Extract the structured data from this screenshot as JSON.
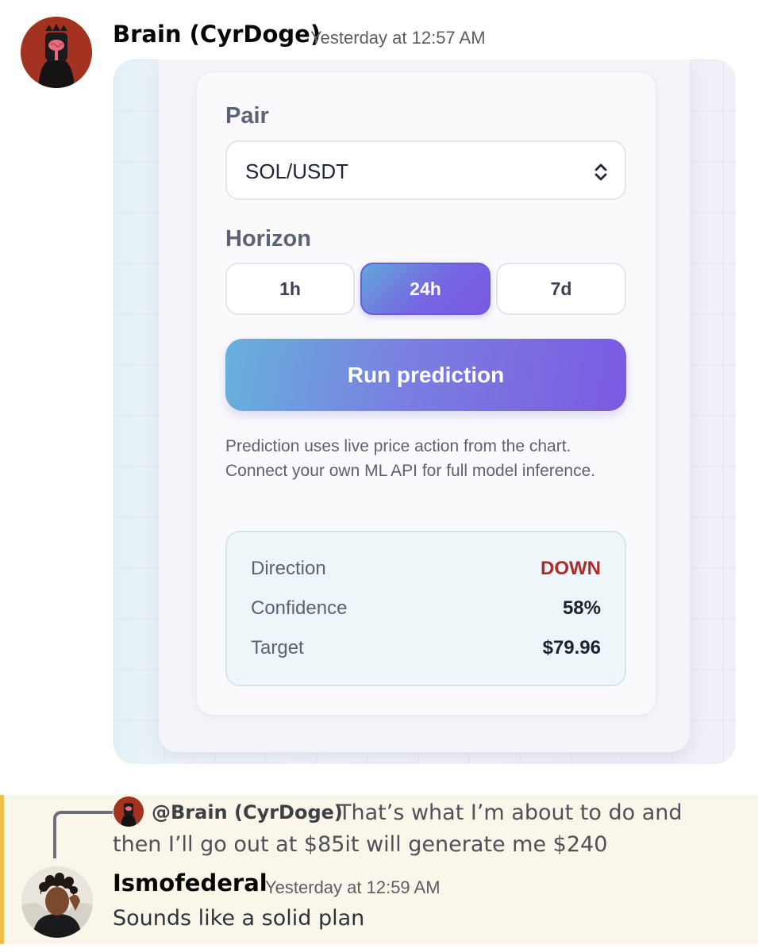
{
  "message1": {
    "author": "Brain (CyrDoge)",
    "timestamp": "Yesterday at 12:57 AM",
    "avatar_icon": "brain-helmet-avatar"
  },
  "prediction_widget": {
    "pair_label": "Pair",
    "pair_value": "SOL/USDT",
    "horizon_label": "Horizon",
    "horizons": [
      "1h",
      "24h",
      "7d"
    ],
    "selected_horizon": "24h",
    "run_button": "Run prediction",
    "note": "Prediction uses live price action from the chart. Connect your own ML API for full model inference.",
    "result": {
      "direction_label": "Direction",
      "direction_value": "DOWN",
      "confidence_label": "Confidence",
      "confidence_value": "58%",
      "target_label": "Target",
      "target_value": "$79.96"
    },
    "colors": {
      "accent_start": "#66b1dc",
      "accent_end": "#7b5ae2",
      "down": "#b02a2a"
    }
  },
  "reply": {
    "replied_author": "@Brain (CyrDoge)",
    "replied_text": "That’s what I’m about to do and then I’ll go out at $85it will generate me $240"
  },
  "message2": {
    "author": "Ismofederal",
    "timestamp": "Yesterday at 12:59 AM",
    "text": "Sounds like a solid plan",
    "avatar_icon": "curly-hair-avatar"
  }
}
